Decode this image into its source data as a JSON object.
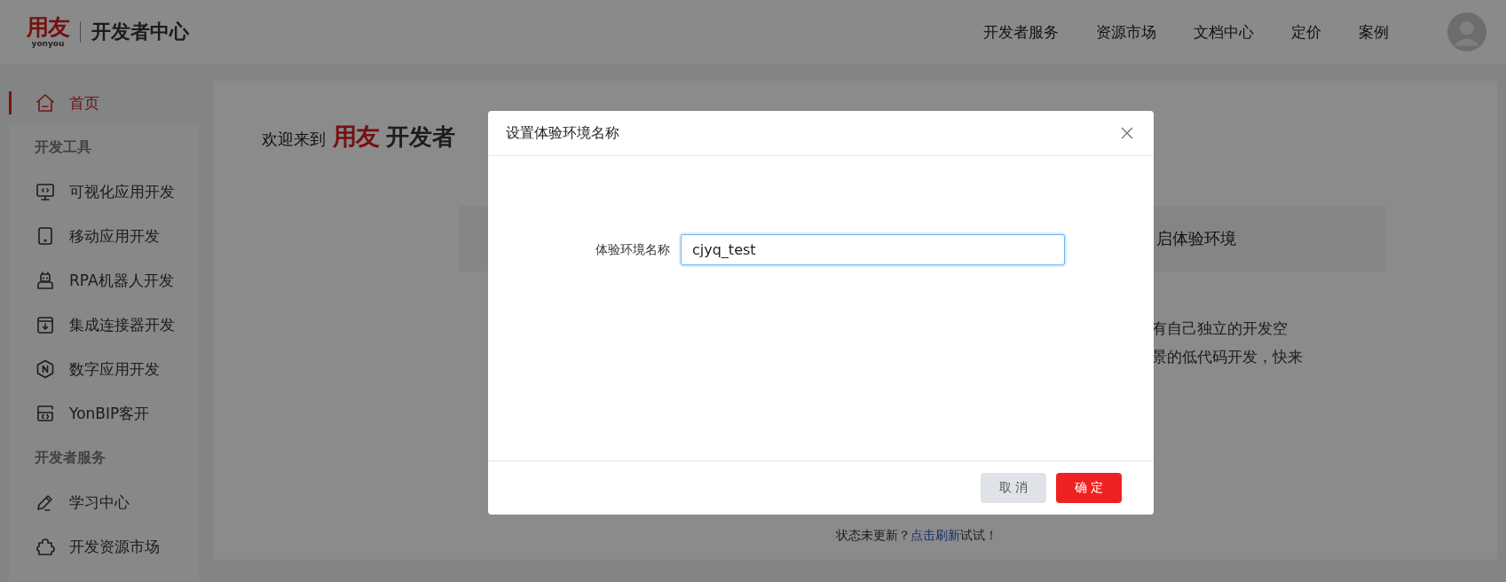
{
  "header": {
    "logo_mark": "用友",
    "logo_sub": "yonyou",
    "title": "开发者中心",
    "nav": [
      {
        "label": "开发者服务"
      },
      {
        "label": "资源市场"
      },
      {
        "label": "文档中心"
      },
      {
        "label": "定价"
      },
      {
        "label": "案例"
      }
    ]
  },
  "sidebar": {
    "items": [
      {
        "kind": "item",
        "label": "首页",
        "selected": true
      },
      {
        "kind": "group",
        "label": "开发工具"
      },
      {
        "kind": "item",
        "label": "可视化应用开发",
        "selected": false
      },
      {
        "kind": "item",
        "label": "移动应用开发",
        "selected": false
      },
      {
        "kind": "item",
        "label": "RPA机器人开发",
        "selected": false
      },
      {
        "kind": "item",
        "label": "集成连接器开发",
        "selected": false
      },
      {
        "kind": "item",
        "label": "数字应用开发",
        "selected": false
      },
      {
        "kind": "item",
        "label": "YonBIP客开",
        "selected": false
      },
      {
        "kind": "group",
        "label": "开发者服务"
      },
      {
        "kind": "item",
        "label": "学习中心",
        "selected": false
      },
      {
        "kind": "item",
        "label": "开发资源市场",
        "selected": false
      }
    ]
  },
  "main": {
    "welcome": "欢迎来到",
    "welcome_logo": "用友",
    "welcome_title": "开发者",
    "panel_text": "启体验环境",
    "description": [
      "有自己独立的开发空",
      "景的低代码开发，快来"
    ],
    "status_text": "状态未更新？",
    "refresh_link": "点击刷新",
    "status_suffix": "试试！"
  },
  "dialog": {
    "title": "设置体验环境名称",
    "field_label": "体验环境名称",
    "field_value": "cjyq_test",
    "buttons": [
      {
        "kind": "cancel",
        "label": "取 消"
      },
      {
        "kind": "ok",
        "label": "确 定"
      }
    ]
  }
}
